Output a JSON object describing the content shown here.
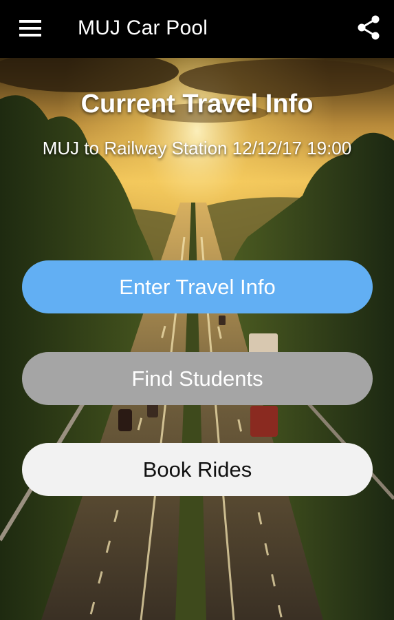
{
  "app_bar": {
    "title": "MUJ Car Pool",
    "menu_icon": "hamburger-menu-icon",
    "share_icon": "share-icon",
    "background": "#000000"
  },
  "main": {
    "heading": "Current Travel Info",
    "travel_info": "MUJ to Railway Station 12/12/17 19:00"
  },
  "buttons": {
    "enter_travel_info": {
      "label": "Enter Travel Info",
      "color": "#62aff3"
    },
    "find_students": {
      "label": "Find Students",
      "color": "#a5a5a5"
    },
    "book_rides": {
      "label": "Book Rides",
      "color": "#f2f2f2"
    }
  }
}
